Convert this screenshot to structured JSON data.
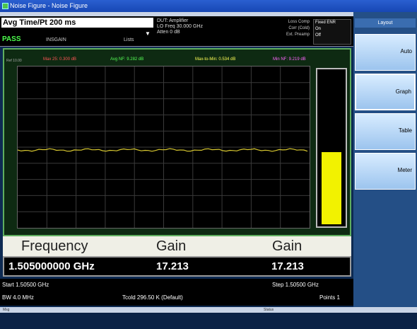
{
  "window": {
    "title": "Noise Figure - Noise Figure"
  },
  "status": {
    "avg_time": "Avg Time/Pt 200 ms",
    "pass": "PASS",
    "input": "INSGAIN",
    "input_val": "Lists",
    "dut_line1": "DUT: Amplifier",
    "dut_line2": "LO Freq 30.000 GHz",
    "dut_line3": "Atten 0 dB",
    "right_labels": [
      "Loss Comp",
      "Corr (Cold)",
      "Ext. Preamp"
    ],
    "right_values": [
      "Fixed ENR",
      "On",
      "Off"
    ]
  },
  "graph": {
    "ref_label": "Ref 10.00",
    "readouts": [
      {
        "text": "Max 25: 0.300 dB",
        "color": "#ff5555"
      },
      {
        "text": "Avg NF: 9.282 dB",
        "color": "#55ff55"
      },
      {
        "text": "Max-to-Min: 0.534 dB",
        "color": "#ffff55"
      },
      {
        "text": "Min NF: 9.219 dB",
        "color": "#ff66ff"
      }
    ],
    "meter_level": 0.46
  },
  "results": {
    "headers": [
      "Frequency",
      "Gain",
      "Gain"
    ],
    "values": [
      "1.505000000 GHz",
      "17.213",
      "17.213"
    ]
  },
  "bottom": {
    "start": "Start 1.50500 GHz",
    "bw": "BW 4.0 MHz",
    "tcold": "Tcold 296.50 K (Default)",
    "step": "Step 1.50500 GHz",
    "points": "Points 1"
  },
  "statusbar": {
    "left": "Msg",
    "right": "Status"
  },
  "softkeys": {
    "title": "Layout",
    "items": [
      "Auto",
      "Graph",
      "Table",
      "Meter"
    ]
  },
  "colors": {
    "trace": "#d8c830",
    "meter": "#f2f200",
    "pass": "#4cff4c"
  }
}
